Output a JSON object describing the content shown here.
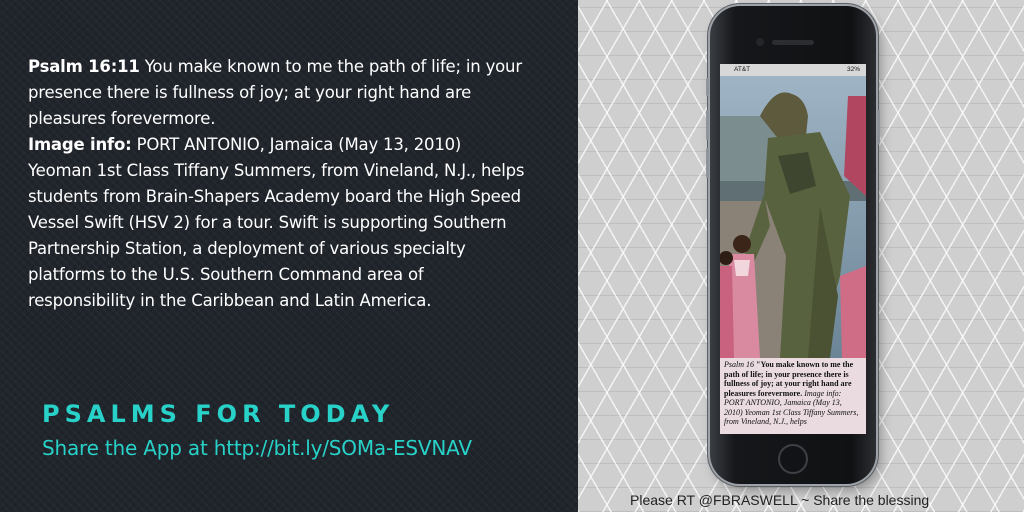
{
  "verse": {
    "ref": "Psalm 16:11",
    "text": " You make known to me the path of life; in your presence there is fullness of joy; at your right hand are pleasures forevermore.",
    "image_info_label": "Image info:",
    "image_info_text": " PORT ANTONIO, Jamaica (May 13, 2010) Yeoman 1st Class Tiffany Summers, from Vineland, N.J., helps students from Brain-Shapers Academy board the High Speed Vessel Swift (HSV 2) for a tour. Swift is supporting Southern Partnership Station, a deployment of various specialty platforms to the U.S. Southern Command area of responsibility in the Caribbean and Latin America."
  },
  "brand": {
    "title": "PSALMS FOR TODAY",
    "share_line": "Share the App at  http://bit.ly/SOMa-ESVNAV"
  },
  "footer_note": "Please RT @FBRASWELL ~ Share the blessing",
  "phone": {
    "carrier": "AT&T",
    "battery": "32%",
    "caption_ref": "Psalm 16",
    "caption_verse": "\"You make known to me the path of life; in your presence there is fullness of joy; at your right hand are pleasures forevermore.",
    "caption_info_label": "Image info:",
    "caption_info_text": " PORT ANTONIO, Jamaica (May 13, 2010) Yeoman 1st Class Tiffany Summers, from Vineland, N.J., helps"
  },
  "colors": {
    "accent": "#28d2c8",
    "left_bg": "#20242b",
    "right_bg": "#cfcfcf"
  }
}
